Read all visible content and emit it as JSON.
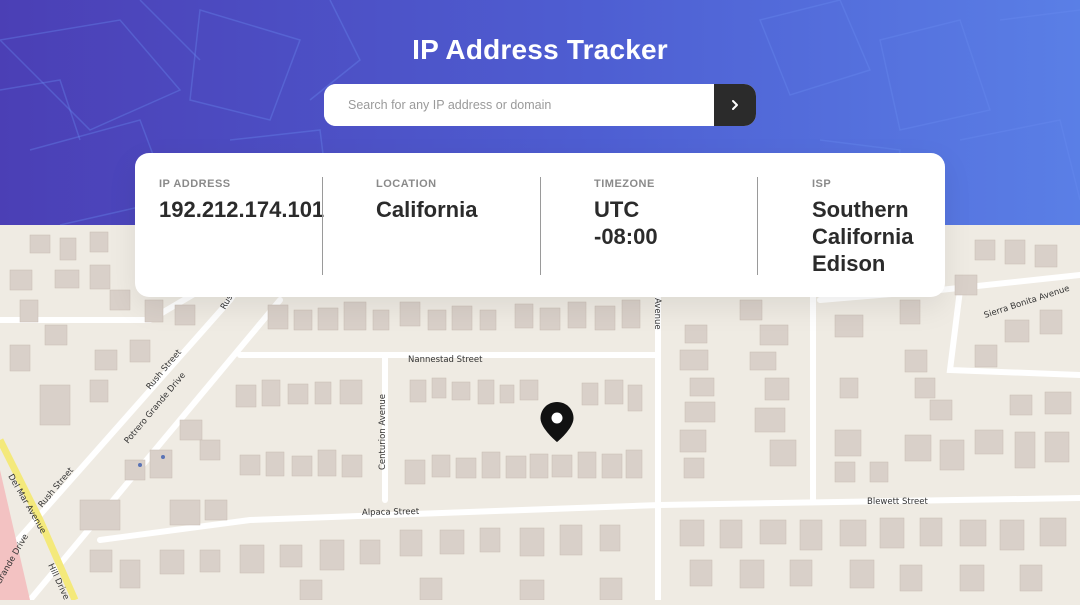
{
  "header": {
    "title": "IP Address Tracker",
    "background": [
      "#4b3fb5",
      "#5a7fe6"
    ]
  },
  "search": {
    "placeholder": "Search for any IP address or domain",
    "value": "",
    "button_icon": "chevron-right-icon"
  },
  "info": {
    "ip": {
      "label": "IP ADDRESS",
      "value": "192.212.174.101"
    },
    "location": {
      "label": "LOCATION",
      "value": "California"
    },
    "timezone": {
      "label": "TIMEZONE",
      "value_line1": "UTC",
      "value_line2": "-08:00"
    },
    "isp": {
      "label": "ISP",
      "value_line1": "Southern",
      "value_line2": "California",
      "value_line3": "Edison"
    }
  },
  "map": {
    "marker_icon": "location-pin-icon",
    "streets": {
      "nannestad": "Nannestad Street",
      "alpaca": "Alpaca Street",
      "blewett": "Blewett Street",
      "centurion": "Centurion Avenue",
      "sierra_bonita": "Sierra Bonita Avenue",
      "rush": "Rush Street",
      "rush_lower": "Rush Street",
      "rush_top": "Rush",
      "potrero": "Potrero Grande Drive",
      "del_mar": "Del Mar Avenue",
      "hill": "Hill Drive",
      "grande": "Grande Drive",
      "avenue": "Avenue"
    }
  }
}
